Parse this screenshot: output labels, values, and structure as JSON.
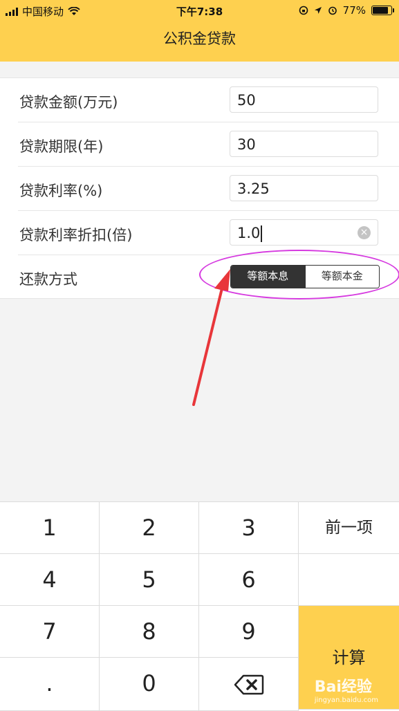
{
  "status_bar": {
    "carrier": "中国移动",
    "time": "下午7:38",
    "battery": "77%"
  },
  "nav": {
    "title": "公积金贷款"
  },
  "form": {
    "rows": [
      {
        "label": "贷款金额(万元)",
        "value": "50"
      },
      {
        "label": "贷款期限(年)",
        "value": "30"
      },
      {
        "label": "贷款利率(%)",
        "value": "3.25"
      },
      {
        "label": "贷款利率折扣(倍)",
        "value": "1.0"
      }
    ],
    "repayment": {
      "label": "还款方式",
      "options": [
        "等额本息",
        "等额本金"
      ],
      "selected": "等额本息"
    }
  },
  "keypad": {
    "keys": [
      "1",
      "2",
      "3",
      "4",
      "5",
      "6",
      "7",
      "8",
      "9",
      ".",
      "0"
    ],
    "prev_label": "前一项",
    "calc_label": "计算"
  },
  "watermark": {
    "text": "Bai经验",
    "sub": "jingyan.baidu.com"
  },
  "colors": {
    "accent": "#fed04f",
    "annotation": "#d63be0",
    "arrow": "#e8363a"
  },
  "icons": [
    "wifi-icon",
    "clear-icon",
    "backspace-icon",
    "arrow-annotation"
  ]
}
